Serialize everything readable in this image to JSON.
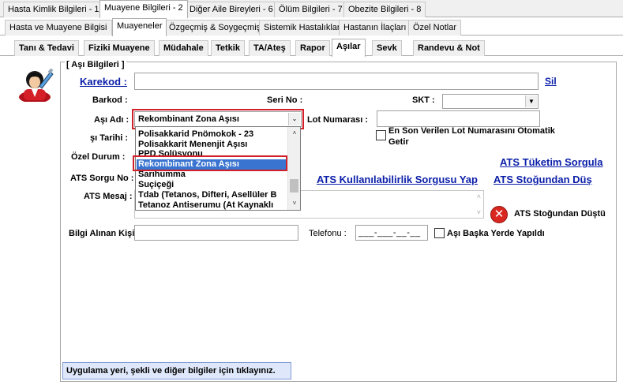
{
  "tabs_top": [
    {
      "label": "Hasta Kimlik Bilgileri - 1",
      "selected": false
    },
    {
      "label": "Muayene Bilgileri - 2",
      "selected": true
    },
    {
      "label": "Diğer Aile Bireyleri - 6",
      "selected": false
    },
    {
      "label": "Ölüm Bilgileri - 7",
      "selected": false
    },
    {
      "label": "Obezite Bilgileri - 8",
      "selected": false
    }
  ],
  "tabs_second": [
    {
      "label": "Hasta ve Muayene Bilgisi",
      "selected": false
    },
    {
      "label": "Muayeneler",
      "selected": true
    },
    {
      "label": "Özgeçmiş & Soygeçmiş",
      "selected": false
    },
    {
      "label": "Sistemik Hastalıklar",
      "selected": false
    },
    {
      "label": "Hastanın İlaçları",
      "selected": false
    },
    {
      "label": "Özel Notlar",
      "selected": false
    }
  ],
  "tabs_third": [
    {
      "label": "Tanı & Tedavi",
      "selected": false
    },
    {
      "label": "Fiziki Muayene",
      "selected": false
    },
    {
      "label": "Müdahale",
      "selected": false
    },
    {
      "label": "Tetkik",
      "selected": false
    },
    {
      "label": "TA/Ateş",
      "selected": false
    },
    {
      "label": "Rapor",
      "selected": false
    },
    {
      "label": "Aşılar",
      "selected": true
    },
    {
      "label": "Sevk",
      "selected": false
    },
    {
      "label": "Randevu & Not",
      "selected": false
    }
  ],
  "form": {
    "group_title": "[ Aşı Bilgileri ]",
    "karekod_label": "Karekod :",
    "karekod_value": "",
    "sil_link": "Sil",
    "barkod_label": "Barkod :",
    "seri_no_label": "Seri No :",
    "skt_label": "SKT :",
    "asi_adi_label": "Aşı Adı :",
    "asi_adi_value": "Rekombinant Zona Aşısı",
    "lot_numarasi_label": "Lot Numarası :",
    "lot_auto_label_line1": "En Son Verilen Lot Numarasını Otomatik",
    "lot_auto_label_line2": "Getir",
    "asi_tarihi_label": "şı Tarihi :",
    "ozel_durum_label": "Özel Durum :",
    "ats_sorgu_no_label": "ATS Sorgu No :",
    "ats_mesaj_label": "ATS Mesaj :",
    "ats_tuketim_link": "ATS Tüketim Sorgula",
    "ats_kullanilabilirlik_link": "ATS Kullanılabilirlik Sorgusu Yap",
    "ats_stogundan_dus_link": "ATS Stoğundan Düş",
    "ats_stogundan_dustu_label": "ATS Stoğundan Düştü",
    "bilgi_alinan_kisi_label": "Bilgi Alınan Kişi",
    "telefonu_label": "Telefonu :",
    "telefonu_value": "___-___-__-__",
    "baska_yerde_label": "Aşı Başka Yerde Yapıldı"
  },
  "dropdown": {
    "items": [
      {
        "label": "Polisakkarid Pnömokok - 23",
        "selected": false
      },
      {
        "label": "Polisakkarit Menenjit Aşısı",
        "selected": false
      },
      {
        "label": "PPD Solüsyonu",
        "selected": false
      },
      {
        "label": "Rekombinant Zona Aşısı",
        "selected": true
      },
      {
        "label": "Sarıhumma",
        "selected": false
      },
      {
        "label": "Suçiçeği",
        "selected": false
      },
      {
        "label": "Tdab (Tetanos, Difteri, Asellüler B",
        "selected": false
      },
      {
        "label": "Tetanoz Antiserumu (At Kaynaklı",
        "selected": false
      }
    ]
  },
  "status_bar": {
    "text": "Uygulama yeri, şekli ve diğer bilgiler için tıklayınız."
  },
  "colors": {
    "link": "#0a1ea8",
    "highlight": "#d0202a",
    "selection": "#3874d0"
  }
}
